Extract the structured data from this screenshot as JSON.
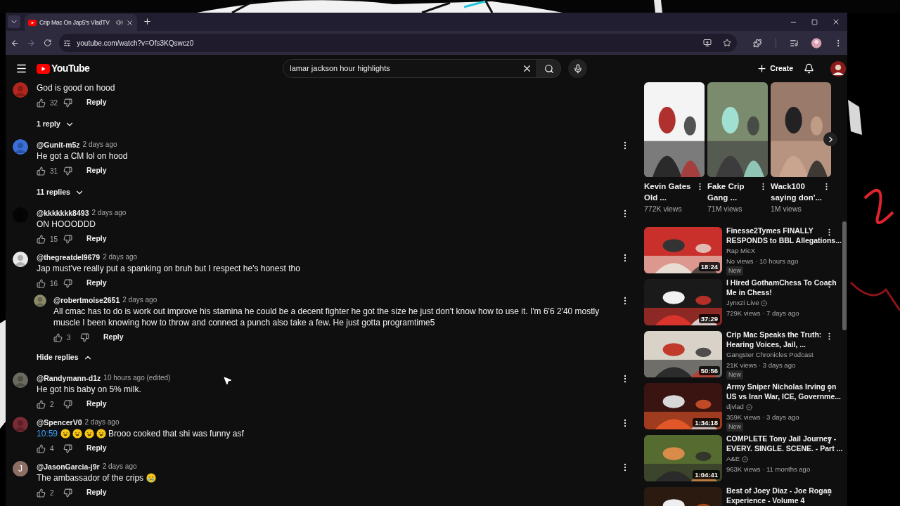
{
  "browser": {
    "tabs": [
      {
        "title": "Crip Mac On Jap5's VladTV",
        "selected": true,
        "audio": true
      }
    ],
    "url": "youtube.com/watch?v=Ofs3KQswcz0",
    "forward_disabled": true
  },
  "header": {
    "logo": "YouTube",
    "search": {
      "value": "lamar jackson hour highlights"
    },
    "create": "Create"
  },
  "comments": [
    {
      "text": "God is good on hood",
      "likes": "32",
      "reply": "Reply",
      "replies": {
        "label": "1 reply",
        "expanded": false
      }
    },
    {
      "author": "@Gunit-m5z",
      "time": "2 days ago",
      "text": "He got a CM lol on hood",
      "likes": "31",
      "reply": "Reply",
      "replies": {
        "label": "11 replies",
        "expanded": false
      }
    },
    {
      "author": "@kkkkkkk8493",
      "time": "2 days ago",
      "text": "ON HOOODDD",
      "likes": "15",
      "reply": "Reply"
    },
    {
      "author": "@thegreatdel9679",
      "time": "2 days ago",
      "text": "Jap must've really put a spanking on bruh but I respect he's honest tho",
      "likes": "16",
      "reply": "Reply",
      "replies": {
        "label": "Hide replies",
        "expanded": true,
        "items": [
          {
            "author": "@robertmoise2651",
            "time": "2 days ago",
            "text": "All cmac has to do is work out improve his stamina he could be a decent fighter he got the size he just don't know how to use it. I'm 6'6 2'40 mostly muscle I been knowing how to throw and connect a punch also take a few. He just gotta programtime5",
            "likes": "3",
            "reply": "Reply"
          }
        ]
      }
    },
    {
      "author": "@Randymann-d1z",
      "time": "10 hours ago (edited)",
      "text": "He got his baby on 5% milk.",
      "likes": "2",
      "reply": "Reply"
    },
    {
      "author": "@SpencerV0",
      "time": "2 days ago",
      "link": "10:59",
      "emojis": [
        {
          "kind": "laugh"
        },
        {
          "kind": "laugh"
        },
        {
          "kind": "laugh"
        },
        {
          "kind": "laugh"
        }
      ],
      "text": "Brooo cooked that shi was funny asf",
      "likes": "4",
      "reply": "Reply"
    },
    {
      "author": "@JasonGarcia-j9r",
      "time": "2 days ago",
      "text": "The ambassador of the crips",
      "emojis_after": [
        {
          "kind": "cry"
        }
      ],
      "likes": "2",
      "reply": "Reply",
      "avatar": {
        "kind": "letter",
        "letter": "J",
        "color": "#8d6e63"
      }
    }
  ],
  "shorts": [
    {
      "title_lines": [
        "Kevin Gates",
        "Old ..."
      ],
      "views": "772K views"
    },
    {
      "title_lines": [
        "Fake Crip",
        "Gang ..."
      ],
      "views": "71M views"
    },
    {
      "title_lines": [
        "Wack100",
        "saying don'..."
      ],
      "views": "1M views"
    }
  ],
  "videos": [
    {
      "title_lines": [
        "Finesse2Tymes FINALLY",
        "RESPONDS to BBL Allegations..."
      ],
      "channel": "Rap MicX",
      "verified": false,
      "meta": "No views · 10 hours ago",
      "badge": "New",
      "duration": "18:24"
    },
    {
      "title_lines": [
        "I Hired GothamChess To Coach",
        "Me in Chess!"
      ],
      "channel": "Jynxzi Live",
      "verified": true,
      "meta": "729K views · 7 days ago",
      "duration": "37:29"
    },
    {
      "title_lines": [
        "Crip Mac Speaks the Truth:",
        "Hearing Voices, Jail, ..."
      ],
      "channel": "Gangster Chronicles Podcast",
      "verified": false,
      "meta": "21K views · 3 days ago",
      "badge": "New",
      "duration": "50:56"
    },
    {
      "title_lines": [
        "Army Sniper Nicholas Irving on",
        "US vs Iran War, ICE, Governme..."
      ],
      "channel": "djvlad",
      "verified": true,
      "meta": "359K views · 3 days ago",
      "badge": "New",
      "duration": "1:34:18"
    },
    {
      "title_lines": [
        "COMPLETE Tony Jail Journey -",
        "EVERY. SINGLE. SCENE. - Part ..."
      ],
      "channel": "A&E",
      "verified": true,
      "meta": "963K views · 11 months ago",
      "duration": "1:04:41"
    },
    {
      "title_lines": [
        "Best of Joey Diaz - Joe Rogan",
        "Experience - Volume 4"
      ]
    }
  ]
}
